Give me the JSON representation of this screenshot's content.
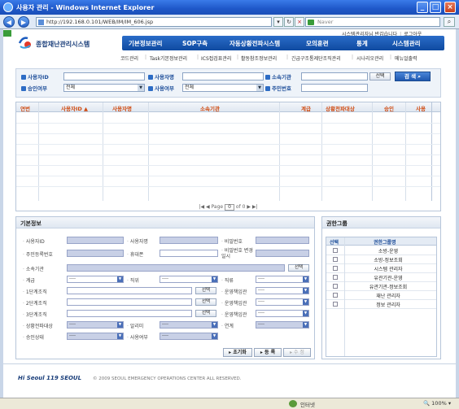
{
  "window": {
    "title": "사용자 관리 - Windows Internet Explorer"
  },
  "address": {
    "url": "http://192.168.0.101/WEB/IM/IM_606.jsp",
    "search_placeholder": "Naver"
  },
  "top_links": {
    "message": "시스템관리자님 반갑습니다",
    "logout": "로그아웃"
  },
  "logo": {
    "text": "종합재난관리시스템"
  },
  "main_nav": [
    "기본정보관리",
    "SOP구축",
    "자동상황전파시스템",
    "모의훈련",
    "통계",
    "시스템관리"
  ],
  "sub_nav": [
    "코드관리",
    "Task기본정보관리",
    "ICS접검표관리",
    "활동참조정보관리",
    "긴급구조통제단조직관리",
    "시나리오관리",
    "메뉴얼출력"
  ],
  "search": {
    "user_id_label": "사용자ID",
    "user_name_label": "사용자명",
    "org_label": "소속기관",
    "approve_label": "승인여부",
    "approve_value": "전체",
    "use_label": "사용여부",
    "use_value": "전체",
    "resident_label": "주민번호",
    "select_btn": "선택",
    "search_btn": "검 색"
  },
  "grid": {
    "headers": [
      "연번",
      "사용자ID",
      "사용자명",
      "소속기관",
      "계급",
      "상황전파대상",
      "승인",
      "사용"
    ],
    "pager": {
      "text_prefix": "Page",
      "current": "0",
      "text_of": "of 0"
    }
  },
  "detail": {
    "title": "기본정보",
    "labels": {
      "user_id": "사용자ID",
      "user_name": "사용자명",
      "password": "비밀번호",
      "resident": "주민등록번호",
      "mobile": "휴대폰",
      "pw_date": "비밀번호 변경일시",
      "org": "소속기관",
      "rank": "계급",
      "position": "직위",
      "duty": "직류",
      "org1": "1단계조직",
      "org2": "2단계조직",
      "org3": "3단계조직",
      "op_assign1": "운영책임관",
      "op_assign2": "운영책임관",
      "op_assign3": "운영책임관",
      "spread": "상황전파대상",
      "alarm": "알리미",
      "link": "연계",
      "approve": "승인상태",
      "use": "사용여부"
    },
    "select_dash": "----",
    "select_btn": "선택",
    "buttons": {
      "reset": "초기화",
      "register": "등 록",
      "edit": "수 정"
    }
  },
  "group": {
    "title": "권한그룹",
    "headers": {
      "select": "선택",
      "name": "권한그룹명"
    },
    "items": [
      "소방-운영",
      "소방-정보조회",
      "시스템 관리자",
      "유관기관-운영",
      "유관기관-정보조회",
      "재난 관리자",
      "정보 관리자"
    ]
  },
  "footer": {
    "logo": "Hi Seoul 119 SEOUL",
    "copyright": "© 2009 SEOUL EMERGENCY OPERATIONS CENTER ALL RESERVED."
  },
  "status": {
    "zone": "인터넷",
    "zoom": "100%"
  }
}
